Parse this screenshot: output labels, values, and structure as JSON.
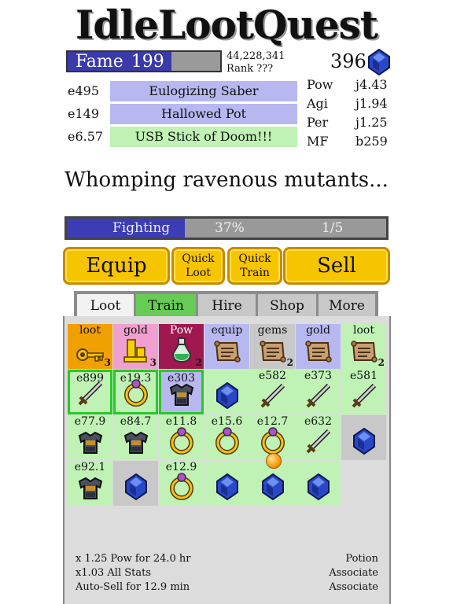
{
  "game": {
    "title": "IdleLootQuest"
  },
  "fame": {
    "label": "Fame",
    "value": "199",
    "progress": 0.68
  },
  "score": {
    "total": "44,228,341",
    "rank": "Rank ???"
  },
  "gems": {
    "count": "396"
  },
  "equipment": [
    {
      "level": "e495",
      "name": "Eulogizing Saber",
      "color": "#b8b8f0"
    },
    {
      "level": "e149",
      "name": "Hallowed Pot",
      "color": "#b8b8f0"
    },
    {
      "level": "e6.57",
      "name": "USB Stick of Doom!!!",
      "color": "#bff2b4"
    }
  ],
  "stats": [
    {
      "name": "Pow",
      "value": "j4.43"
    },
    {
      "name": "Agi",
      "value": "j1.94"
    },
    {
      "name": "Per",
      "value": "j1.25"
    },
    {
      "name": "MF",
      "value": "b259"
    }
  ],
  "message": "Whomping ravenous mutants...",
  "fight": {
    "label": "Fighting",
    "percent": "37%",
    "wave": "1/5",
    "progress": 0.37
  },
  "buttons": {
    "equip": "Equip",
    "quick_loot_1": "Quick",
    "quick_loot_2": "Loot",
    "quick_train_1": "Quick",
    "quick_train_2": "Train",
    "sell": "Sell"
  },
  "tabs": [
    "Loot",
    "Train",
    "Hire",
    "Shop",
    "More"
  ],
  "grid": {
    "row1": [
      {
        "label": "loot",
        "count": "3",
        "icon": "key-icon",
        "bg": "#f0a000"
      },
      {
        "label": "gold",
        "count": "3",
        "icon": "gold-icon",
        "bg": "#f0a0d0"
      },
      {
        "label": "Pow",
        "count": "2",
        "icon": "potion-icon",
        "bg": "#a01850"
      },
      {
        "label": "equip",
        "count": "",
        "icon": "scroll-icon",
        "bg": "#b8b8f0"
      },
      {
        "label": "gems",
        "count": "2",
        "icon": "scroll-icon",
        "bg": "#c8c8c8"
      },
      {
        "label": "gold",
        "count": "",
        "icon": "scroll-icon",
        "bg": "#b8b8f0"
      },
      {
        "label": "loot",
        "count": "2",
        "icon": "scroll-icon",
        "bg": "#bff2b4"
      }
    ],
    "row2": [
      {
        "label": "e899",
        "icon": "sword-icon",
        "bg": "#bff2b4",
        "selected": true
      },
      {
        "label": "e19.3",
        "icon": "ring-icon",
        "bg": "#bff2b4",
        "selected": true
      },
      {
        "label": "e303",
        "icon": "armor-icon",
        "bg": "#b8b8f0",
        "selected": true
      },
      {
        "label": "",
        "icon": "gem-icon",
        "bg": "#bff2b4"
      },
      {
        "label": "e582",
        "icon": "sword-icon",
        "bg": "#bff2b4"
      },
      {
        "label": "e373",
        "icon": "sword-icon",
        "bg": "#bff2b4"
      },
      {
        "label": "e581",
        "icon": "sword-icon",
        "bg": "#bff2b4"
      }
    ],
    "row3": [
      {
        "label": "e77.9",
        "icon": "armor-icon",
        "bg": "#bff2b4"
      },
      {
        "label": "e84.7",
        "icon": "armor-icon",
        "bg": "#bff2b4"
      },
      {
        "label": "e11.8",
        "icon": "ring-icon",
        "bg": "#bff2b4"
      },
      {
        "label": "e15.6",
        "icon": "ring-icon",
        "bg": "#bff2b4"
      },
      {
        "label": "e12.7",
        "icon": "ring-icon",
        "bg": "#bff2b4"
      },
      {
        "label": "e632",
        "icon": "sword-icon",
        "bg": "#bff2b4"
      },
      {
        "label": "",
        "icon": "gem-icon",
        "bg": "#c8c8c8"
      }
    ],
    "row4": [
      {
        "label": "e92.1",
        "icon": "armor-icon",
        "bg": "#bff2b4"
      },
      {
        "label": "",
        "icon": "gem-icon",
        "bg": "#c8c8c8"
      },
      {
        "label": "e12.9",
        "icon": "ring-icon",
        "bg": "#bff2b4"
      },
      {
        "label": "",
        "icon": "gem-icon",
        "bg": "#bff2b4"
      },
      {
        "label": "",
        "icon": "gem-icon",
        "bg": "#bff2b4"
      },
      {
        "label": "",
        "icon": "gem-icon",
        "bg": "#bff2b4"
      }
    ]
  },
  "buffs": [
    {
      "text": "x 1.25 Pow for 24.0 hr",
      "source": "Potion"
    },
    {
      "text": "x1.03 All Stats",
      "source": "Associate"
    },
    {
      "text": "Auto-Sell for 12.9 min",
      "source": "Associate"
    }
  ],
  "colors": {
    "accent_blue": "#3a3aa8",
    "button_yellow": "#f7c400",
    "green": "#66cc55"
  }
}
